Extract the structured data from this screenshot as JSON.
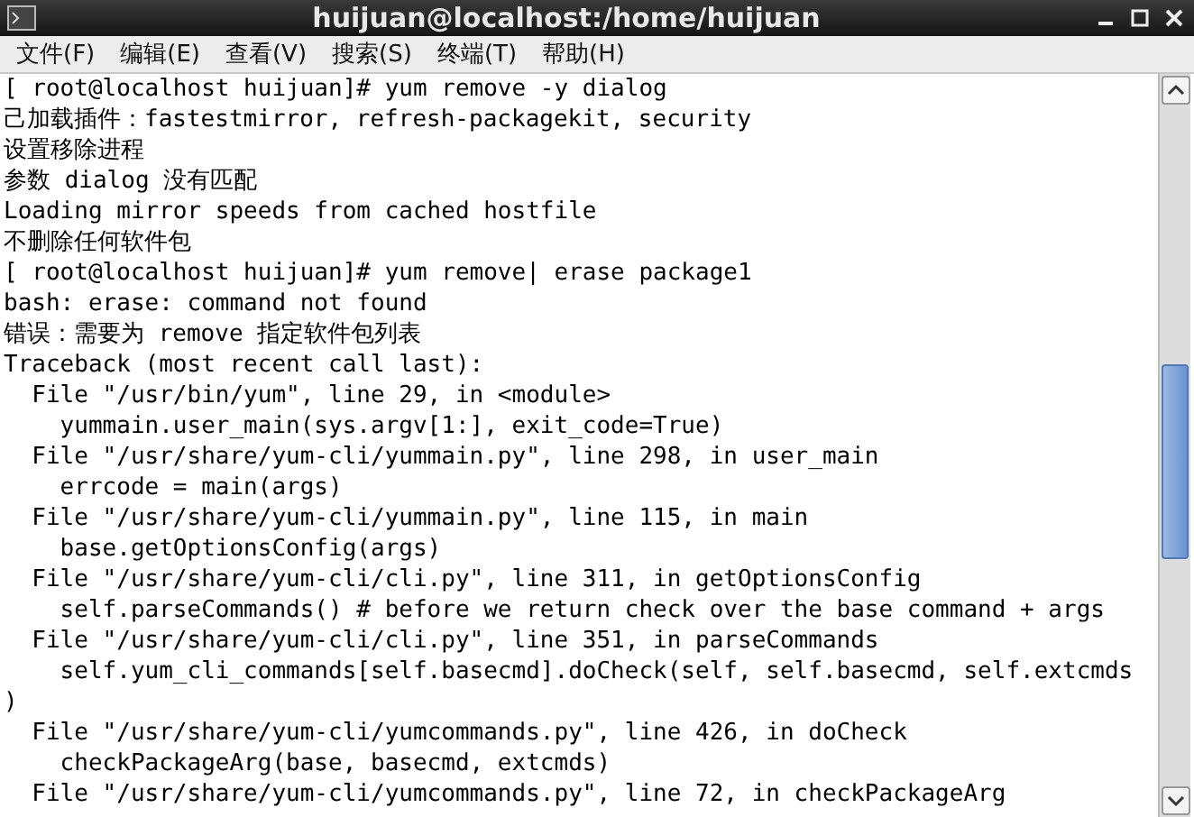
{
  "window": {
    "title": "huijuan@localhost:/home/huijuan"
  },
  "menu": [
    "文件(F)",
    "编辑(E)",
    "查看(V)",
    "搜索(S)",
    "终端(T)",
    "帮助(H)"
  ],
  "terminal": {
    "lines": [
      "[ root@localhost huijuan]# yum remove -y dialog",
      "己加载插件：fastestmirror, refresh-packagekit, security",
      "设置移除进程",
      "参数 dialog 没有匹配",
      "Loading mirror speeds from cached hostfile",
      "不删除任何软件包",
      "[ root@localhost huijuan]# yum remove| erase package1",
      "bash: erase: command not found",
      "错误：需要为 remove 指定软件包列表",
      "Traceback (most recent call last):",
      "  File \"/usr/bin/yum\", line 29, in <module>",
      "    yummain.user_main(sys.argv[1:], exit_code=True)",
      "  File \"/usr/share/yum-cli/yummain.py\", line 298, in user_main",
      "    errcode = main(args)",
      "  File \"/usr/share/yum-cli/yummain.py\", line 115, in main",
      "    base.getOptionsConfig(args)",
      "  File \"/usr/share/yum-cli/cli.py\", line 311, in getOptionsConfig",
      "    self.parseCommands() # before we return check over the base command + args",
      "  File \"/usr/share/yum-cli/cli.py\", line 351, in parseCommands",
      "    self.yum_cli_commands[self.basecmd].doCheck(self, self.basecmd, self.extcmds",
      ")",
      "  File \"/usr/share/yum-cli/yumcommands.py\", line 426, in doCheck",
      "    checkPackageArg(base, basecmd, extcmds)",
      "  File \"/usr/share/yum-cli/yumcommands.py\", line 72, in checkPackageArg"
    ]
  }
}
